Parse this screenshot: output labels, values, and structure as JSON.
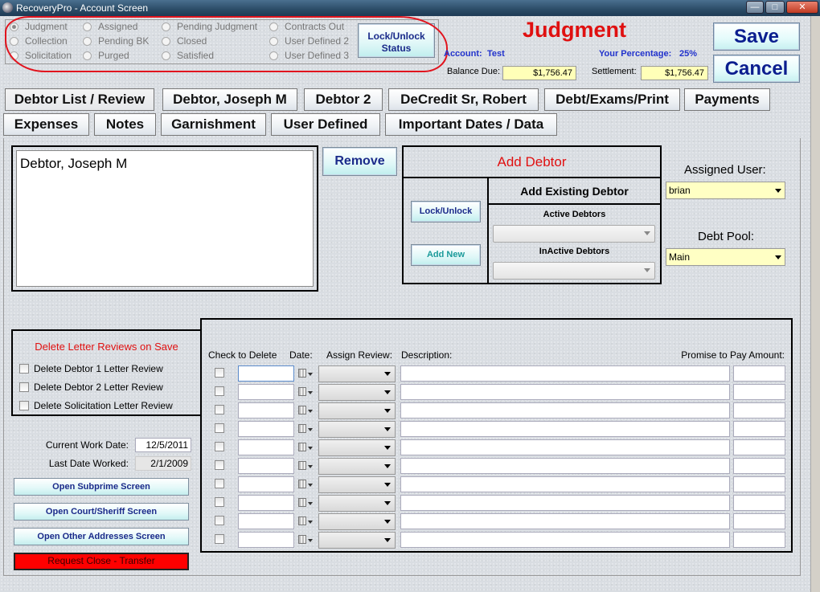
{
  "window": {
    "title": "RecoveryPro - Account Screen"
  },
  "status": {
    "options": [
      {
        "label": "Judgment",
        "selected": true
      },
      {
        "label": "Collection",
        "selected": false
      },
      {
        "label": "Solicitation",
        "selected": false
      },
      {
        "label": "Assigned",
        "selected": false
      },
      {
        "label": "Pending BK",
        "selected": false
      },
      {
        "label": "Purged",
        "selected": false
      },
      {
        "label": "Pending Judgment",
        "selected": false
      },
      {
        "label": "Closed",
        "selected": false
      },
      {
        "label": "Satisfied",
        "selected": false
      },
      {
        "label": "Contracts Out",
        "selected": false
      },
      {
        "label": "User Defined 2",
        "selected": false
      },
      {
        "label": "User Defined 3",
        "selected": false
      }
    ],
    "lock_label_1": "Lock/Unlock",
    "lock_label_2": "Status"
  },
  "header": {
    "status_title": "Judgment",
    "account_label": "Account:",
    "account_value": "Test",
    "percentage_label": "Your Percentage:",
    "percentage_value": "25%",
    "balance_label": "Balance Due:",
    "balance_value": "$1,756.47",
    "settlement_label": "Settlement:",
    "settlement_value": "$1,756.47",
    "save_label": "Save",
    "cancel_label": "Cancel"
  },
  "tabs_row1": [
    "Debtor List / Review",
    "Debtor, Joseph M",
    "Debtor 2",
    "DeCredit Sr, Robert",
    "Debt/Exams/Print",
    "Payments"
  ],
  "tabs_row2": [
    "Expenses",
    "Notes",
    "Garnishment",
    "User Defined",
    "Important Dates / Data"
  ],
  "active_tab": "Debtor List / Review",
  "debtors": {
    "list": [
      "Debtor, Joseph M"
    ],
    "remove_label": "Remove",
    "add_debtor_title": "Add Debtor",
    "add_existing_title": "Add Existing Debtor",
    "lock_unlock_label": "Lock/Unlock",
    "add_new_label": "Add New",
    "active_label": "Active Debtors",
    "inactive_label": "InActive Debtors"
  },
  "assignment": {
    "assigned_user_label": "Assigned User:",
    "assigned_user_value": "brian",
    "debt_pool_label": "Debt Pool:",
    "debt_pool_value": "Main"
  },
  "delete_reviews": {
    "title": "Delete Letter Reviews on Save",
    "options": [
      "Delete Debtor 1 Letter Review",
      "Delete Debtor 2 Letter Review",
      "Delete Solicitation Letter Review"
    ]
  },
  "dates": {
    "current_label": "Current Work Date:",
    "current_value": "12/5/2011",
    "last_label": "Last Date Worked:",
    "last_value": "2/1/2009"
  },
  "nav_buttons": {
    "subprime": "Open Subprime Screen",
    "court": "Open Court/Sheriff Screen",
    "addresses": "Open Other Addresses Screen",
    "close_transfer": "Request Close - Transfer"
  },
  "review_grid": {
    "headers": {
      "check": "Check to Delete",
      "date": "Date:",
      "assign": "Assign Review:",
      "description": "Description:",
      "promise": "Promise to Pay Amount:"
    },
    "row_count": 10
  }
}
